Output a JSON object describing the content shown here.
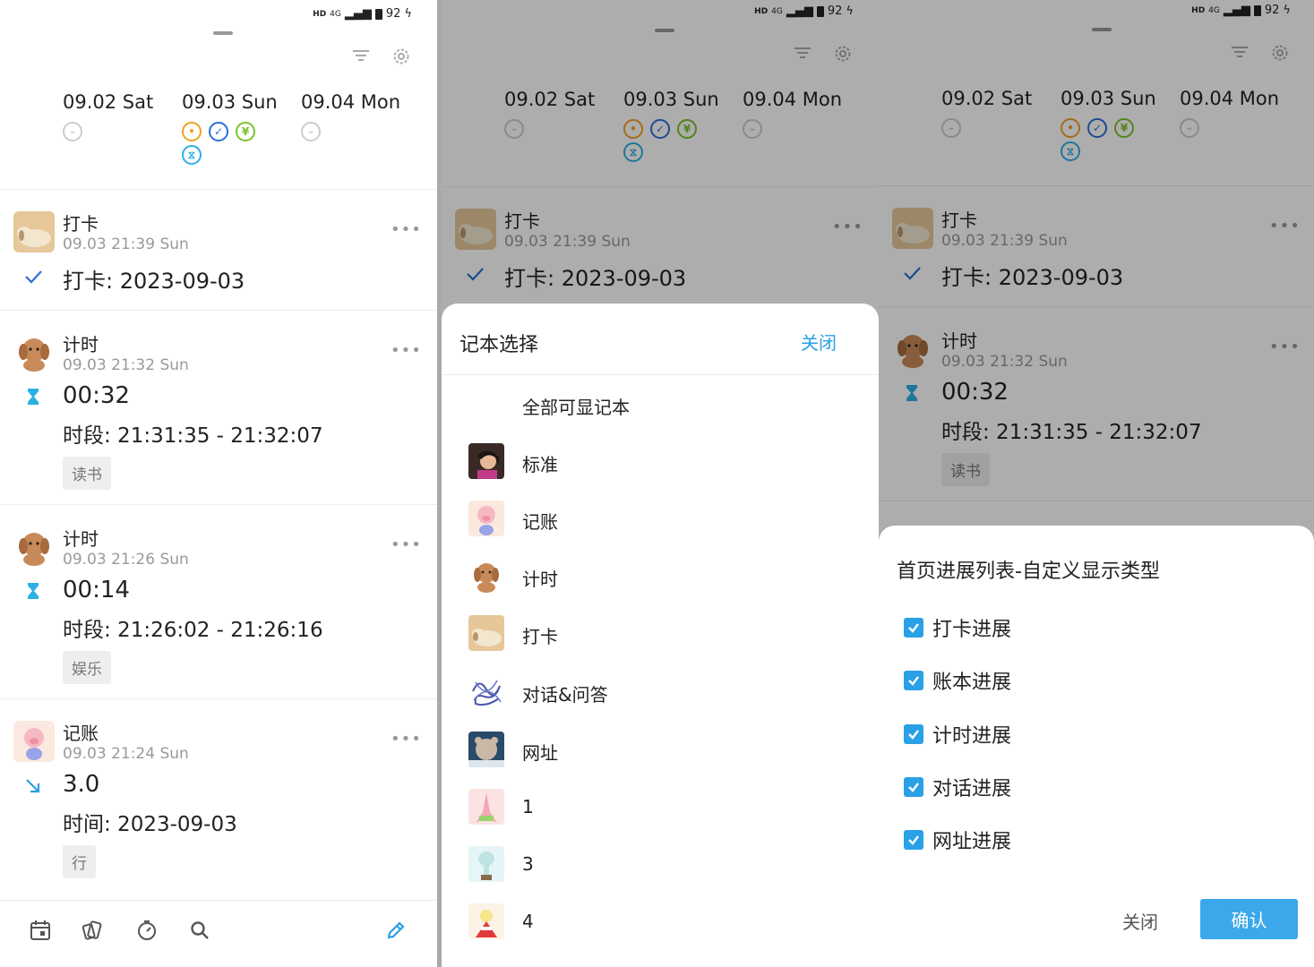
{
  "status": {
    "hd": "HD",
    "sig": "4G",
    "battery": "92"
  },
  "dates": [
    {
      "label": "09.02 Sat",
      "icons": [
        "minus"
      ]
    },
    {
      "label": "09.03 Sun",
      "icons": [
        "dot",
        "check",
        "yen",
        "hour"
      ]
    },
    {
      "label": "09.04 Mon",
      "icons": [
        "minus"
      ]
    }
  ],
  "entries": [
    {
      "title": "打卡",
      "time": "09.03 21:39 Sun",
      "type": "check",
      "main": "打卡: 2023-09-03",
      "sub": "",
      "tag": ""
    },
    {
      "title": "计时",
      "time": "09.03 21:32 Sun",
      "type": "hourglass",
      "main": "00:32",
      "sub": "时段: 21:31:35 - 21:32:07",
      "tag": "读书"
    },
    {
      "title": "计时",
      "time": "09.03 21:26 Sun",
      "type": "hourglass",
      "main": "00:14",
      "sub": "时段: 21:26:02 - 21:26:16",
      "tag": "娱乐"
    },
    {
      "title": "记账",
      "time": "09.03 21:24 Sun",
      "type": "arrow",
      "main": "3.0",
      "sub": "时间: 2023-09-03",
      "tag": "行"
    }
  ],
  "more": "•••",
  "notebook_sheet": {
    "title": "记本选择",
    "close": "关闭",
    "items": [
      "全部可显记本",
      "标准",
      "记账",
      "计时",
      "打卡",
      "对话&问答",
      "网址",
      "1",
      "3",
      "4"
    ]
  },
  "display_sheet": {
    "title": "首页进展列表-自定义显示类型",
    "options": [
      "打卡进展",
      "账本进展",
      "计时进展",
      "对话进展",
      "网址进展"
    ],
    "close": "关闭",
    "confirm": "确认"
  },
  "colors": {
    "accent": "#2aa0e6",
    "check": "#2a6fd8",
    "yen": "#7cc12b",
    "dot": "#f0a020"
  }
}
